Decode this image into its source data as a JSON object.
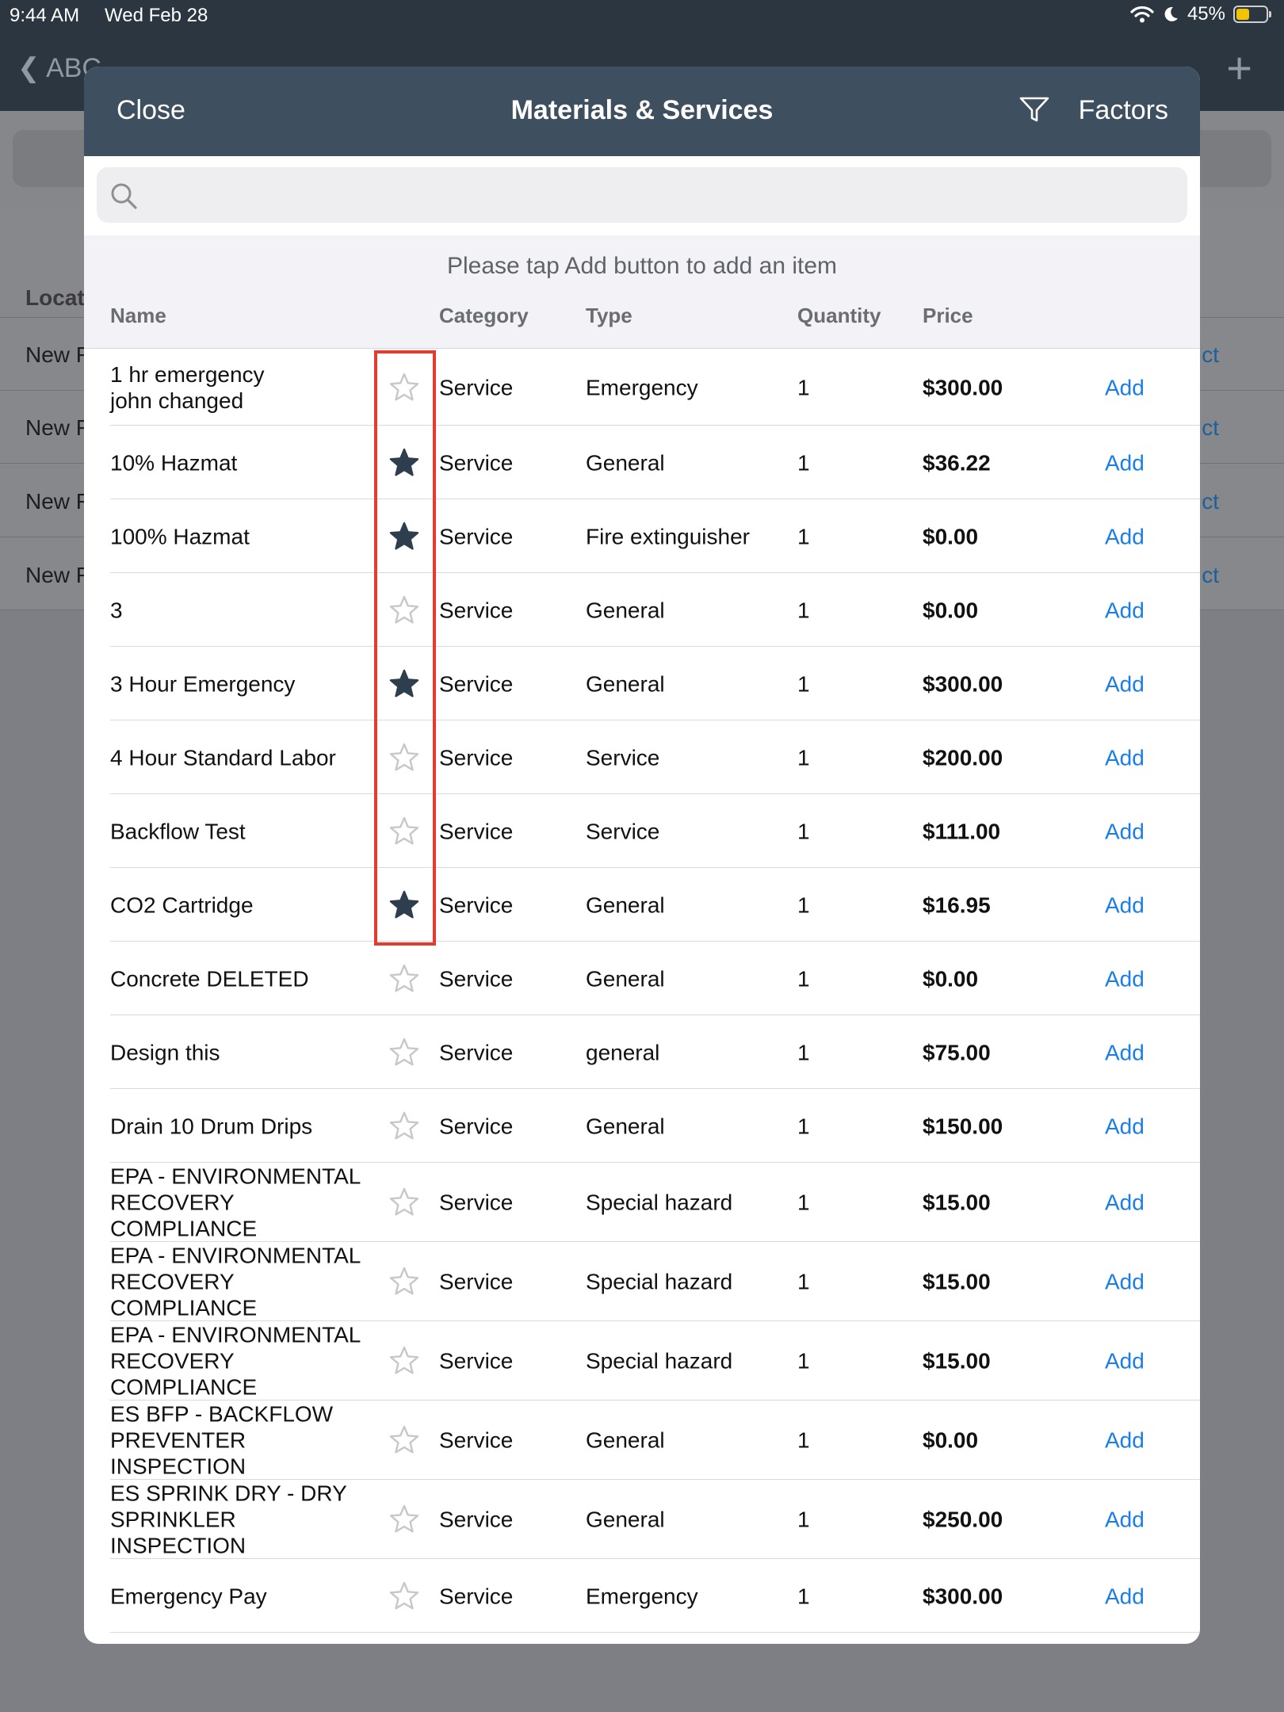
{
  "status_bar": {
    "time": "9:44 AM",
    "date": "Wed Feb 28",
    "battery": "45%"
  },
  "background": {
    "back_label": "ABC",
    "section_header": "Locat",
    "rows": [
      "New F",
      "New F",
      "New F",
      "New F"
    ],
    "row_action": "ct"
  },
  "modal": {
    "close_label": "Close",
    "title": "Materials & Services",
    "factors_label": "Factors",
    "search": {
      "placeholder": "",
      "value": ""
    },
    "hint": "Please tap Add button to add an item",
    "columns": {
      "name": "Name",
      "category": "Category",
      "type": "Type",
      "quantity": "Quantity",
      "price": "Price"
    },
    "items": [
      {
        "name": "1 hr emergency\njohn changed",
        "favorite": false,
        "category": "Service",
        "type": "Emergency",
        "quantity": "1",
        "price": "$300.00",
        "action": "Add"
      },
      {
        "name": "10% Hazmat",
        "favorite": true,
        "category": "Service",
        "type": "General",
        "quantity": "1",
        "price": "$36.22",
        "action": "Add"
      },
      {
        "name": "100% Hazmat",
        "favorite": true,
        "category": "Service",
        "type": "Fire extinguisher",
        "quantity": "1",
        "price": "$0.00",
        "action": "Add"
      },
      {
        "name": "3",
        "favorite": false,
        "category": "Service",
        "type": "General",
        "quantity": "1",
        "price": "$0.00",
        "action": "Add"
      },
      {
        "name": "3 Hour Emergency",
        "favorite": true,
        "category": "Service",
        "type": "General",
        "quantity": "1",
        "price": "$300.00",
        "action": "Add"
      },
      {
        "name": "4 Hour Standard Labor",
        "favorite": false,
        "category": "Service",
        "type": "Service",
        "quantity": "1",
        "price": "$200.00",
        "action": "Add"
      },
      {
        "name": "Backflow Test",
        "favorite": false,
        "category": "Service",
        "type": "Service",
        "quantity": "1",
        "price": "$111.00",
        "action": "Add"
      },
      {
        "name": "CO2 Cartridge",
        "favorite": true,
        "category": "Service",
        "type": "General",
        "quantity": "1",
        "price": "$16.95",
        "action": "Add"
      },
      {
        "name": "Concrete DELETED",
        "favorite": false,
        "category": "Service",
        "type": "General",
        "quantity": "1",
        "price": "$0.00",
        "action": "Add"
      },
      {
        "name": "Design this",
        "favorite": false,
        "category": "Service",
        "type": "general",
        "quantity": "1",
        "price": "$75.00",
        "action": "Add"
      },
      {
        "name": "Drain 10 Drum Drips",
        "favorite": false,
        "category": "Service",
        "type": "General",
        "quantity": "1",
        "price": "$150.00",
        "action": "Add"
      },
      {
        "name": "EPA - ENVIRONMENTAL\nRECOVERY COMPLIANCE",
        "favorite": false,
        "category": "Service",
        "type": "Special hazard",
        "quantity": "1",
        "price": "$15.00",
        "action": "Add"
      },
      {
        "name": "EPA - ENVIRONMENTAL\nRECOVERY COMPLIANCE",
        "favorite": false,
        "category": "Service",
        "type": "Special hazard",
        "quantity": "1",
        "price": "$15.00",
        "action": "Add"
      },
      {
        "name": "EPA - ENVIRONMENTAL\nRECOVERY COMPLIANCE",
        "favorite": false,
        "category": "Service",
        "type": "Special hazard",
        "quantity": "1",
        "price": "$15.00",
        "action": "Add"
      },
      {
        "name": "ES BFP - BACKFLOW\nPREVENTER INSPECTION",
        "favorite": false,
        "category": "Service",
        "type": "General",
        "quantity": "1",
        "price": "$0.00",
        "action": "Add"
      },
      {
        "name": "ES SPRINK DRY - DRY\nSPRINKLER INSPECTION",
        "favorite": false,
        "category": "Service",
        "type": "General",
        "quantity": "1",
        "price": "$250.00",
        "action": "Add"
      },
      {
        "name": "Emergency Pay",
        "favorite": false,
        "category": "Service",
        "type": "Emergency",
        "quantity": "1",
        "price": "$300.00",
        "action": "Add"
      }
    ]
  },
  "colors": {
    "header": "#3e4f5f",
    "accent": "#1a7ee6",
    "highlight": "#e33b2e",
    "star_filled": "#2e3e4e",
    "star_empty": "#c7c7cc"
  }
}
